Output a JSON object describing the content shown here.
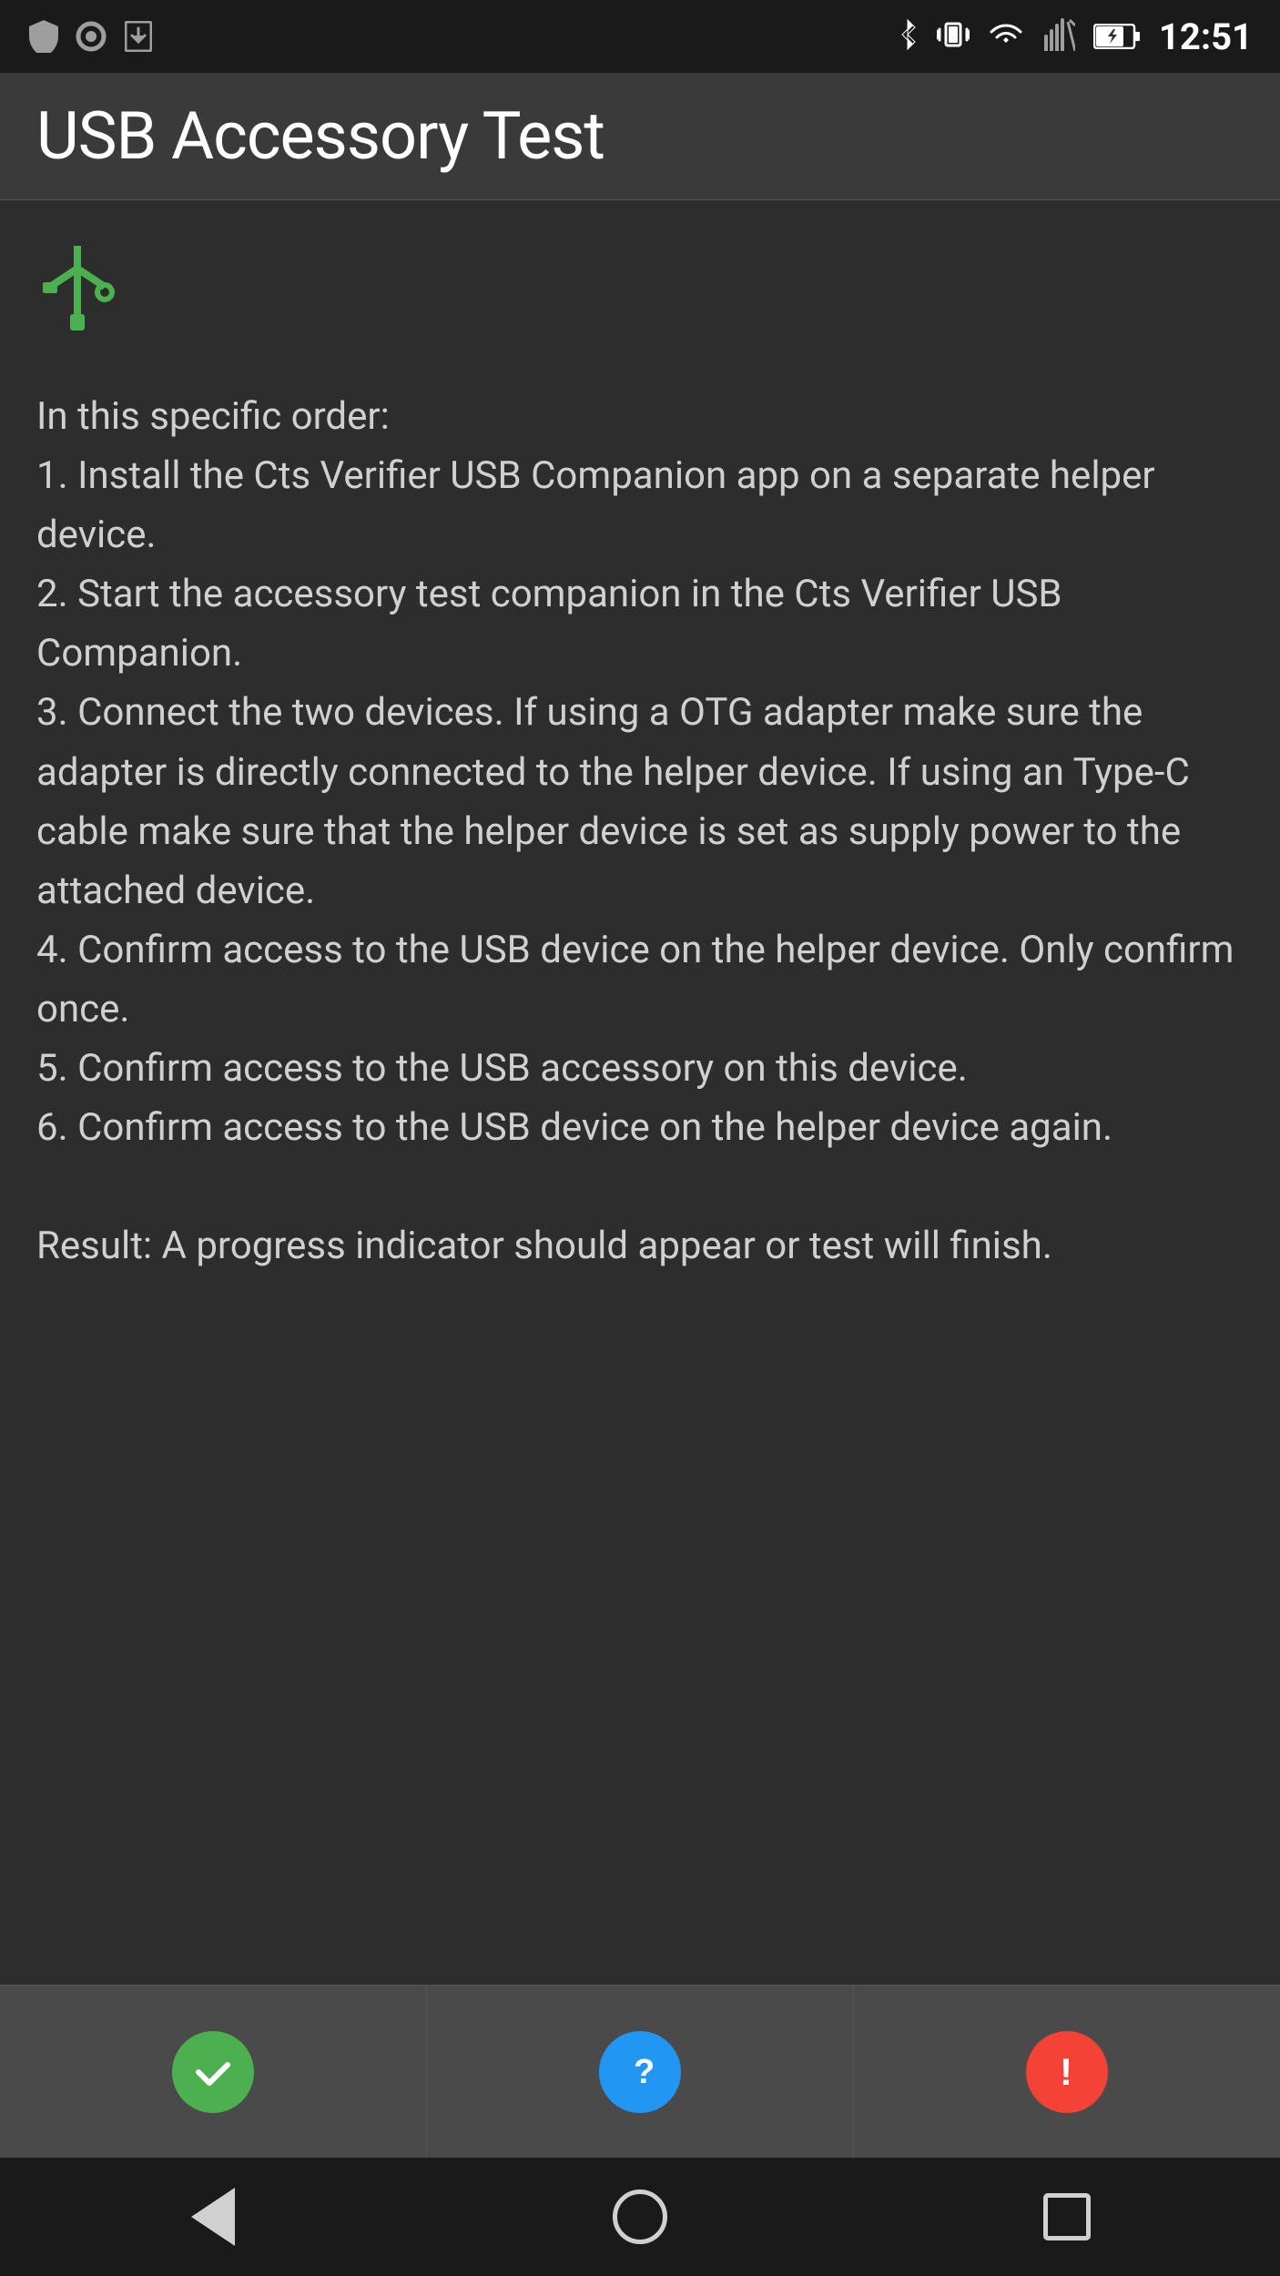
{
  "statusBar": {
    "time": "12:51",
    "leftIcons": [
      "shield",
      "circle",
      "download"
    ],
    "rightIcons": [
      "bluetooth",
      "vibrate",
      "wifi",
      "signal",
      "battery"
    ]
  },
  "appBar": {
    "title": "USB Accessory Test"
  },
  "content": {
    "usbIconLabel": "usb-symbol",
    "instructions": "In this specific order:\n1. Install the Cts Verifier USB Companion app on a separate helper device.\n2. Start the accessory test companion in the Cts Verifier USB Companion.\n3. Connect the two devices. If using a OTG adapter make sure the adapter is directly connected to the helper device. If using an Type-C cable make sure that the helper device is set as supply power to the attached device.\n4. Confirm access to the USB device on the helper device. Only confirm once.\n5. Confirm access to the USB accessory on this device.\n6. Confirm access to the USB device on the helper device again.",
    "result": "Result: A progress indicator should appear or test will finish."
  },
  "bottomBar": {
    "passLabel": "pass",
    "infoLabel": "info",
    "failLabel": "fail"
  },
  "navBar": {
    "backLabel": "back",
    "homeLabel": "home",
    "recentsLabel": "recents"
  }
}
